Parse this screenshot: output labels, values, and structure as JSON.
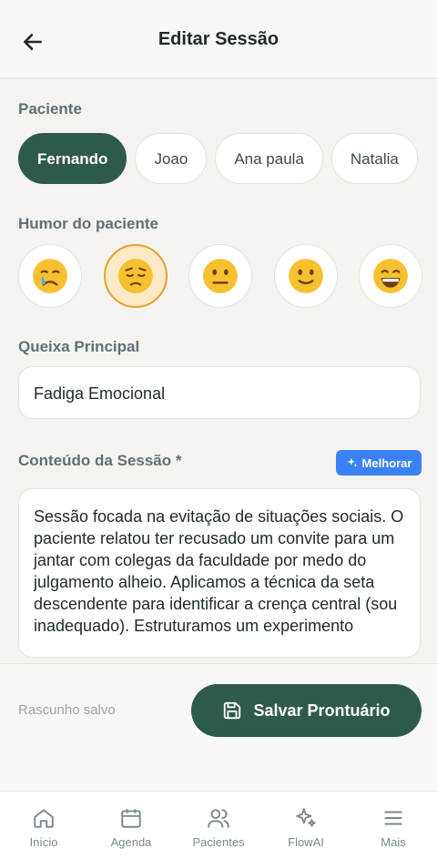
{
  "header": {
    "title": "Editar Sessão"
  },
  "patient": {
    "label": "Paciente",
    "chips": [
      {
        "label": "Fernando",
        "active": true
      },
      {
        "label": "Joao"
      },
      {
        "label": "Ana paula"
      },
      {
        "label": "Natalia"
      }
    ]
  },
  "mood": {
    "label": "Humor do paciente",
    "options": [
      {
        "icon": "crying-face-icon"
      },
      {
        "icon": "pensive-face-icon",
        "selected": true
      },
      {
        "icon": "neutral-face-icon"
      },
      {
        "icon": "slight-smile-face-icon"
      },
      {
        "icon": "grinning-face-icon"
      }
    ]
  },
  "complaint": {
    "label": "Queixa Principal",
    "value": "Fadiga Emocional"
  },
  "session": {
    "label": "Conteúdo da Sessão *",
    "improve_label": "Melhorar",
    "content": "Sessão focada na evitação de situações sociais. O paciente relatou ter recusado um convite para um jantar com colegas da faculdade por medo do julgamento alheio. Aplicamos a técnica da seta descendente para identificar a crença central (sou inadequado). Estruturamos um experimento"
  },
  "footer": {
    "status": "Rascunho salvo",
    "save_label": "Salvar Prontuário"
  },
  "nav": {
    "items": [
      {
        "label": "Início",
        "icon": "home-icon"
      },
      {
        "label": "Agenda",
        "icon": "calendar-icon"
      },
      {
        "label": "Pacientes",
        "icon": "users-icon"
      },
      {
        "label": "FlowAI",
        "icon": "sparkles-icon"
      },
      {
        "label": "Mais",
        "icon": "menu-icon"
      }
    ]
  },
  "colors": {
    "primary": "#2f5a4b",
    "accent": "#3b82f6",
    "mood_selected": "#e0a22e"
  }
}
